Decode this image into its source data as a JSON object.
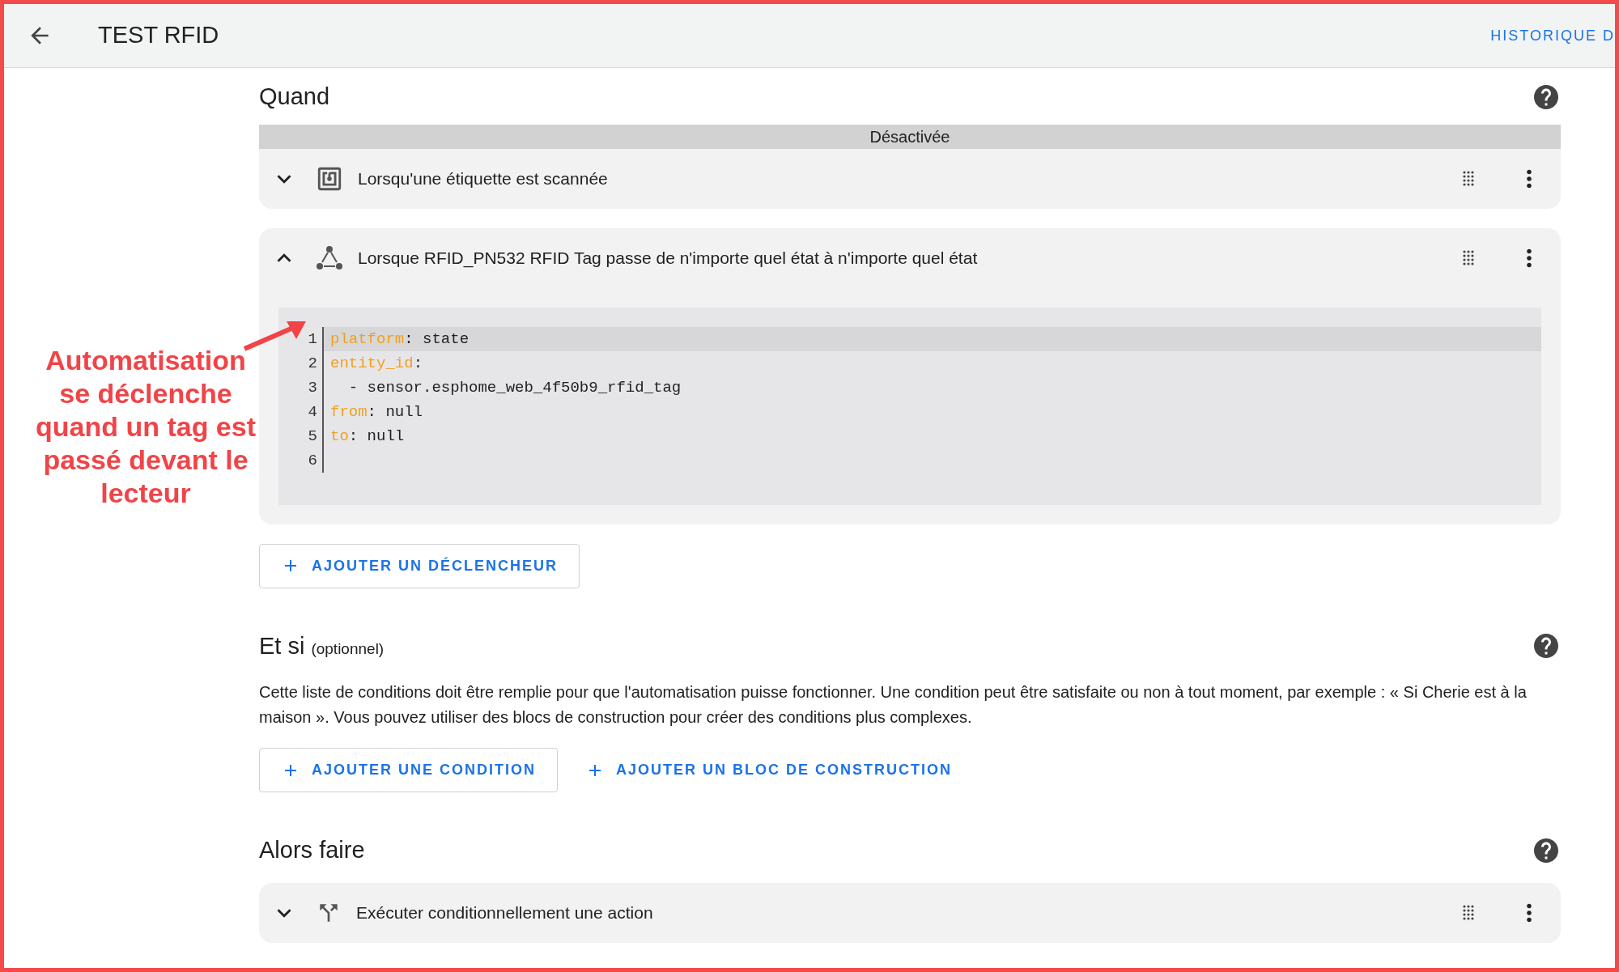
{
  "header": {
    "title": "TEST RFID",
    "link": "HISTORIQUE D"
  },
  "annotation": {
    "text": "Automatisation se déclenche quand un tag est passé devant le lecteur"
  },
  "when": {
    "title": "Quand",
    "triggers": [
      {
        "kind": "tag",
        "label": "Lorsqu'une étiquette est scannée",
        "expanded": false,
        "disabled": true,
        "disabled_label": "Désactivée"
      },
      {
        "kind": "state",
        "label": "Lorsque RFID_PN532 RFID Tag passe de n'importe quel état à n'importe quel état",
        "expanded": true,
        "disabled": false,
        "code": [
          {
            "number": "1",
            "key": "platform",
            "rest": ": state",
            "selected": true
          },
          {
            "number": "2",
            "key": "entity_id",
            "rest": ":",
            "selected": false
          },
          {
            "number": "3",
            "rest": "  - sensor.esphome_web_4f50b9_rfid_tag",
            "selected": false
          },
          {
            "number": "4",
            "key": "from",
            "rest": ": null",
            "selected": false
          },
          {
            "number": "5",
            "key": "to",
            "rest": ": null",
            "selected": false
          },
          {
            "number": "6",
            "selected": false
          }
        ]
      }
    ],
    "buttons": [
      {
        "label": "AJOUTER UN DÉCLENCHEUR",
        "outlined": true
      }
    ]
  },
  "if": {
    "title": "Et si",
    "subtitle": "(optionnel)",
    "description": "Cette liste de conditions doit être remplie pour que l'automatisation puisse fonctionner. Une condition peut être satisfaite ou non à tout moment, par exemple : « Si Cherie est à la maison ». Vous pouvez utiliser des blocs de construction pour créer des conditions plus complexes.",
    "buttons": [
      {
        "label": "AJOUTER UNE CONDITION",
        "outlined": true
      },
      {
        "label": "AJOUTER UN BLOC DE CONSTRUCTION",
        "outlined": false
      }
    ]
  },
  "then": {
    "title": "Alors faire",
    "actions": [
      {
        "kind": "choose",
        "label": "Exécuter conditionnellement une action",
        "expanded": false,
        "disabled": false
      }
    ]
  }
}
